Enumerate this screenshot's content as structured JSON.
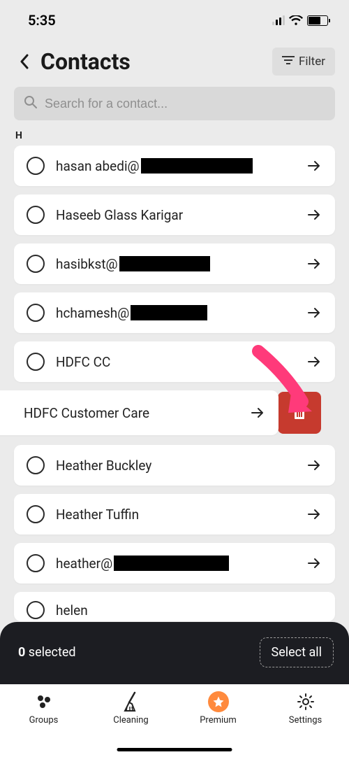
{
  "status": {
    "time": "5:35"
  },
  "header": {
    "title": "Contacts",
    "filter_label": "Filter"
  },
  "search": {
    "placeholder": "Search for a contact..."
  },
  "section_letter": "H",
  "contacts": [
    {
      "label": "hasan abedi@",
      "redacted_width": 160
    },
    {
      "label": "Haseeb Glass Karigar",
      "redacted_width": 0
    },
    {
      "label": "hasibkst@",
      "redacted_width": 130
    },
    {
      "label": "hchamesh@",
      "redacted_width": 110
    },
    {
      "label": "HDFC CC",
      "redacted_width": 0
    }
  ],
  "swiped": {
    "label": "HDFC Customer Care"
  },
  "contacts2": [
    {
      "label": "Heather Buckley",
      "redacted_width": 0
    },
    {
      "label": "Heather Tuffin",
      "redacted_width": 0
    },
    {
      "label": "heather@",
      "redacted_width": 165
    },
    {
      "label": "helen",
      "redacted_width": 0
    }
  ],
  "selection": {
    "count": "0",
    "label_suffix": " selected",
    "select_all": "Select all"
  },
  "tabs": {
    "groups": "Groups",
    "cleaning": "Cleaning",
    "premium": "Premium",
    "settings": "Settings"
  }
}
